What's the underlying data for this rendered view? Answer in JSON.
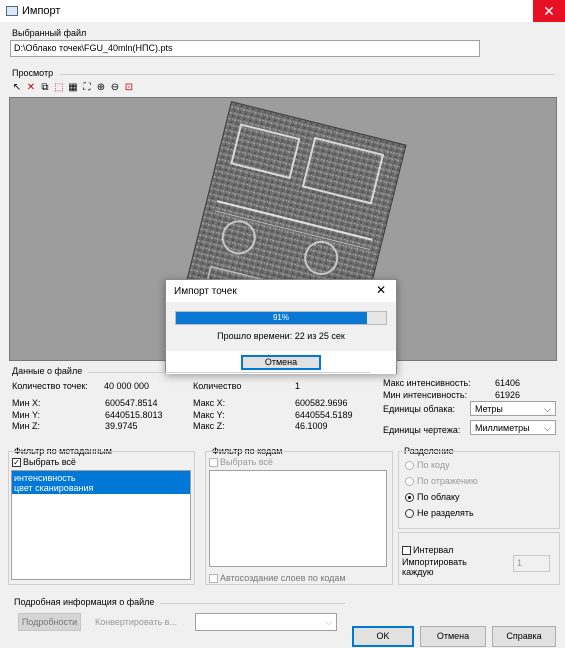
{
  "window": {
    "title": "Импорт"
  },
  "selected_file": {
    "group_label": "Выбранный файл",
    "path": "D:\\Облако точек\\FGU_40mln(НПС).pts"
  },
  "preview": {
    "group_label": "Просмотр",
    "tools": [
      "pointer-icon",
      "delete-icon",
      "select-icon",
      "box-select-icon",
      "fill-icon",
      "fit-icon",
      "zoom-in-icon",
      "zoom-out-icon",
      "zoom-window-icon"
    ]
  },
  "progress_dialog": {
    "title": "Импорт точек",
    "percent": 91,
    "percent_text": "91%",
    "elapsed": "Прошло времени: 22 из 25 сек",
    "cancel": "Отмена"
  },
  "file_data": {
    "group_label": "Данные о файле",
    "point_count_label": "Количество точек:",
    "point_count_value": "40 000 000",
    "min_x_label": "Мин X:",
    "min_x": "600547.8514",
    "min_y_label": "Мин Y:",
    "min_y": "6440515.8013",
    "min_z_label": "Мин Z:",
    "min_z": "39.9745",
    "count_label": "Количество",
    "count_value": "1",
    "max_x_label": "Макс X:",
    "max_x": "600582.9696",
    "max_y_label": "Макс Y:",
    "max_y": "6440554.5189",
    "max_z_label": "Макс Z:",
    "max_z": "46.1009",
    "max_int_label": "Макс интенсивность:",
    "max_int": "61406",
    "min_int_label": "Мин интенсивность:",
    "min_int": "61926",
    "cloud_units_label": "Единицы облака:",
    "cloud_units": "Метры",
    "drawing_units_label": "Единицы чертежа:",
    "drawing_units": "Миллиметры"
  },
  "meta_filter": {
    "group_label": "Фильтр по метаданным",
    "select_all": "Выбрать всё",
    "items": [
      "интенсивность",
      "цвет сканирования"
    ]
  },
  "code_filter": {
    "group_label": "Фильтр по кодам",
    "select_all": "Выбрать всё",
    "auto_layers": "Автосоздание слоев по кодам"
  },
  "separation": {
    "group_label": "Разделение",
    "options": [
      "По коду",
      "По отражению",
      "По облаку",
      "Не разделять"
    ],
    "selected": "По облаку"
  },
  "interval": {
    "label": "Интервал",
    "import_each_label": "Импортировать каждую",
    "value": "1"
  },
  "details": {
    "group_label": "Подробная информация о файле",
    "details_button": "Подробности",
    "convert_label": "Конвертировать в..."
  },
  "buttons": {
    "ok": "OK",
    "cancel": "Отмена",
    "help": "Справка"
  }
}
